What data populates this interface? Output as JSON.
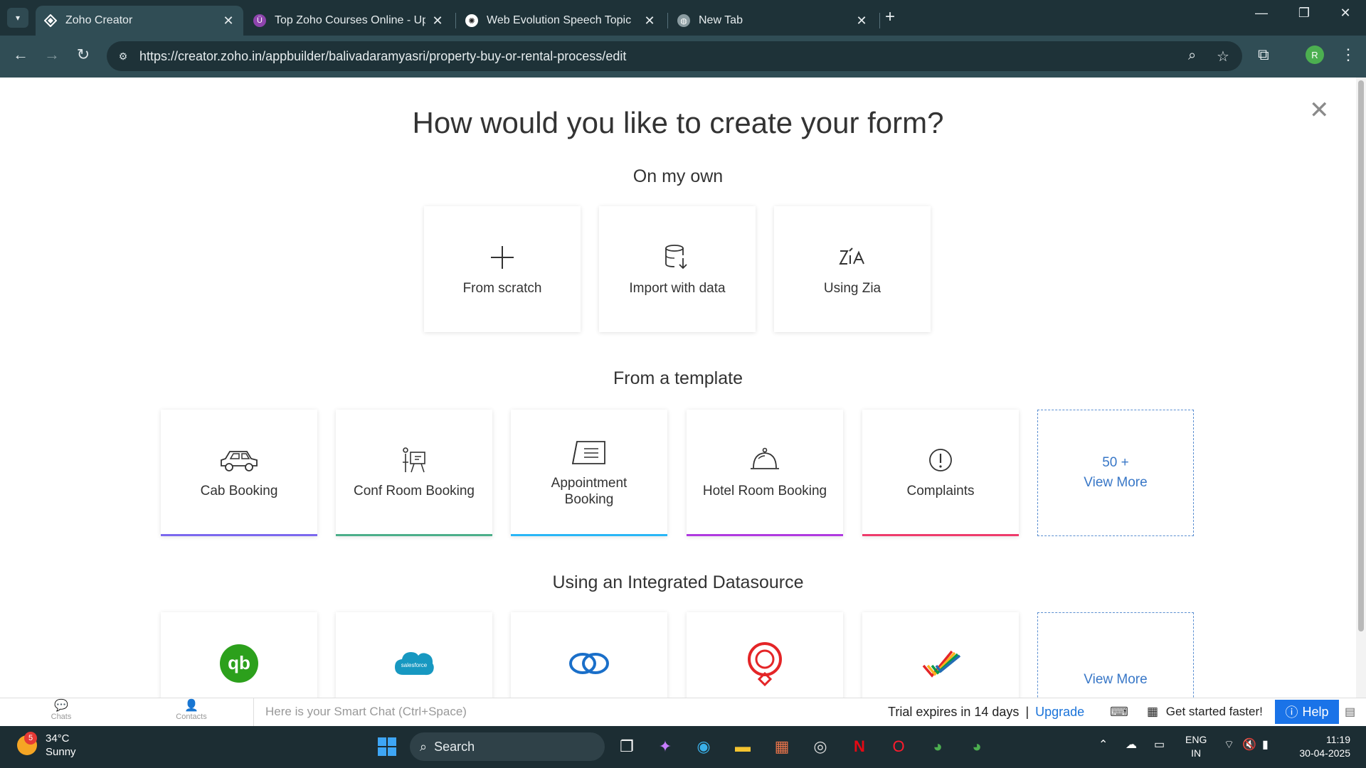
{
  "browser": {
    "tabs": [
      {
        "title": "Zoho Creator",
        "active": true
      },
      {
        "title": "Top Zoho Courses Online - Upd",
        "active": false
      },
      {
        "title": "Web Evolution Speech Topic",
        "active": false
      },
      {
        "title": "New Tab",
        "active": false
      }
    ],
    "url": "https://creator.zoho.in/appbuilder/balivadaramyasri/property-buy-or-rental-process/edit",
    "profile_initial": "R"
  },
  "page": {
    "heading": "How would you like to create your form?",
    "own_section": {
      "title": "On my own",
      "cards": [
        {
          "label": "From scratch",
          "icon": "plus-icon"
        },
        {
          "label": "Import with data",
          "icon": "database-import-icon"
        },
        {
          "label": "Using Zia",
          "icon": "zia-icon"
        }
      ]
    },
    "template_section": {
      "title": "From a template",
      "cards": [
        {
          "label": "Cab Booking",
          "icon": "car-icon",
          "accent": "#7b68ee"
        },
        {
          "label": "Conf Room Booking",
          "icon": "conference-icon",
          "accent": "#4caf8a"
        },
        {
          "label": "Appointment Booking",
          "icon": "appointment-icon",
          "accent": "#29b6f6"
        },
        {
          "label": "Hotel Room Booking",
          "icon": "bell-icon",
          "accent": "#b039e0"
        },
        {
          "label": "Complaints",
          "icon": "alert-icon",
          "accent": "#ee3b6b"
        }
      ],
      "more_count": "50 +",
      "more_label": "View More"
    },
    "datasource_section": {
      "title": "Using an Integrated Datasource",
      "cards": [
        {
          "icon": "quickbooks-icon"
        },
        {
          "icon": "salesforce-icon",
          "badge_text": "salesforce"
        },
        {
          "icon": "zoho-crm-icon"
        },
        {
          "icon": "zoho-recruit-icon"
        },
        {
          "icon": "zoho-projects-icon"
        }
      ],
      "more_label": "View More"
    }
  },
  "zoho_bar": {
    "chats": "Chats",
    "contacts": "Contacts",
    "smart_chat_placeholder": "Here is your Smart Chat (Ctrl+Space)",
    "trial_text": "Trial expires in 14 days",
    "separator": "|",
    "upgrade": "Upgrade",
    "get_started": "Get started faster!",
    "help": "Help"
  },
  "taskbar": {
    "weather_badge": "5",
    "temperature": "34°C",
    "condition": "Sunny",
    "search": "Search",
    "lang_line1": "ENG",
    "lang_line2": "IN",
    "time": "11:19",
    "date": "30-04-2025"
  }
}
